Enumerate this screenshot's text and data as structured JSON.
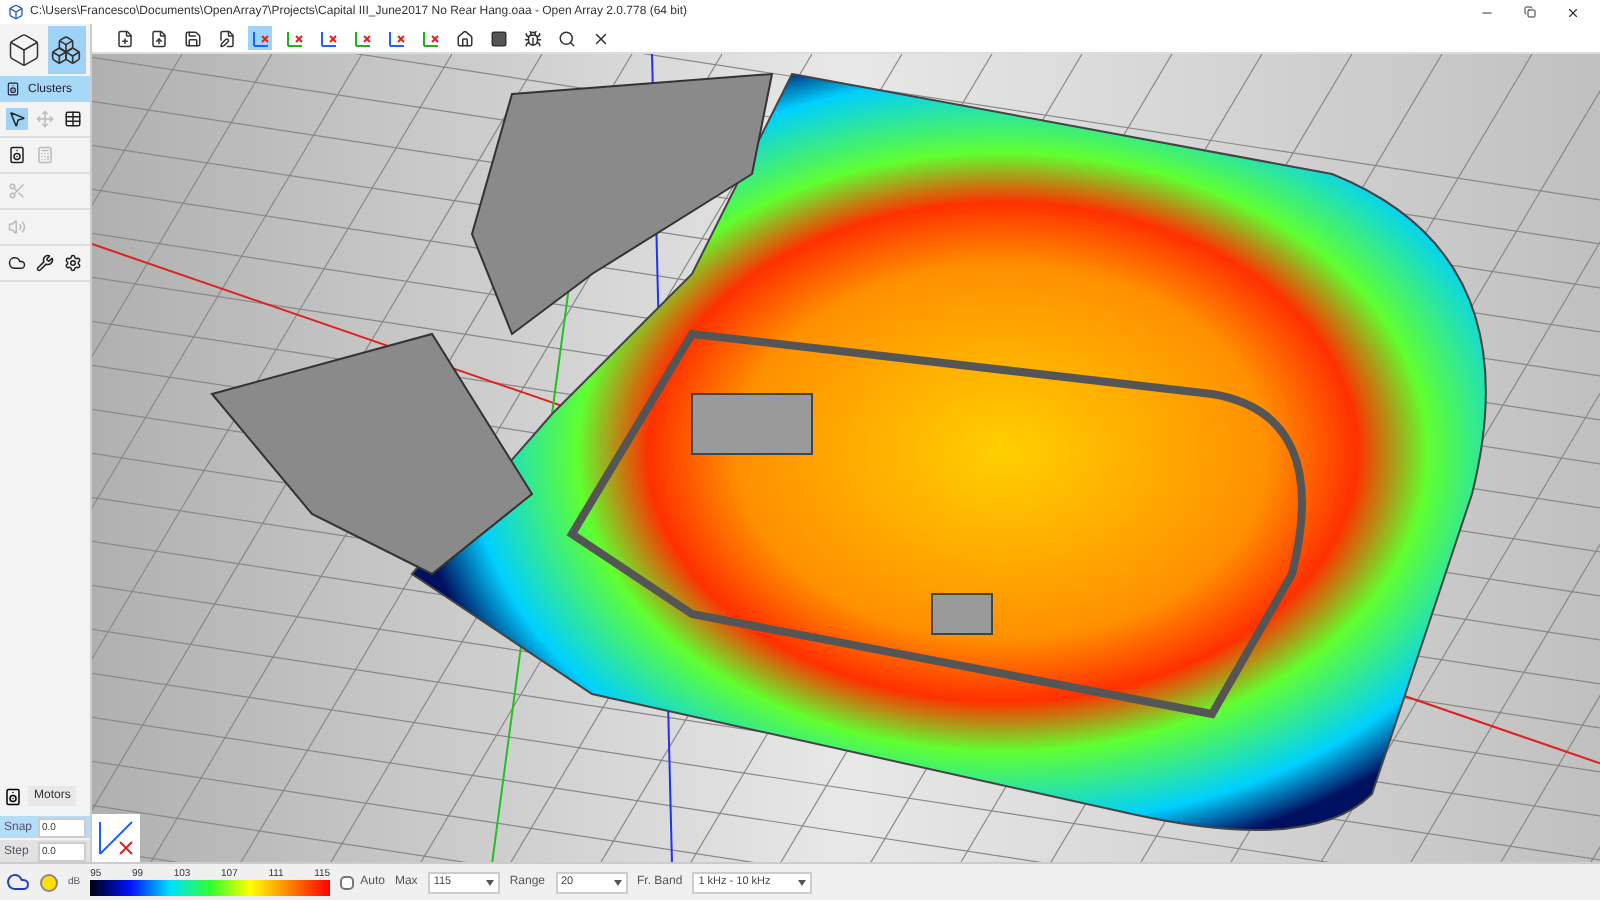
{
  "window": {
    "title": "C:\\Users\\Francesco\\Documents\\OpenArray7\\Projects\\Capital III_June2017 No Rear Hang.oaa - Open Array 2.0.778 (64 bit)"
  },
  "toolbar": {
    "view_buttons": [
      {
        "selected": true
      },
      {
        "selected": false
      },
      {
        "selected": false
      },
      {
        "selected": false
      },
      {
        "selected": false
      },
      {
        "selected": false
      }
    ]
  },
  "sidebar": {
    "tab": {
      "label": "Clusters",
      "selected": true
    },
    "tools": [
      {
        "selected": true
      },
      {
        "selected": false
      },
      {
        "selected": false
      }
    ],
    "motors": "Motors",
    "fields": [
      {
        "label": "Snap",
        "value": "0.0",
        "selected": true
      },
      {
        "label": "Step",
        "value": "0.0",
        "selected": false
      }
    ]
  },
  "bottom_bar": {
    "unit": "dB",
    "ticks": [
      "95",
      "99",
      "103",
      "107",
      "111",
      "115"
    ],
    "auto": {
      "label": "Auto",
      "checked": false
    },
    "max": {
      "label": "Max",
      "value": "115"
    },
    "range": {
      "label": "Range",
      "value": "20"
    },
    "band": {
      "label": "Fr. Band",
      "value": "1 kHz - 10 kHz"
    }
  }
}
